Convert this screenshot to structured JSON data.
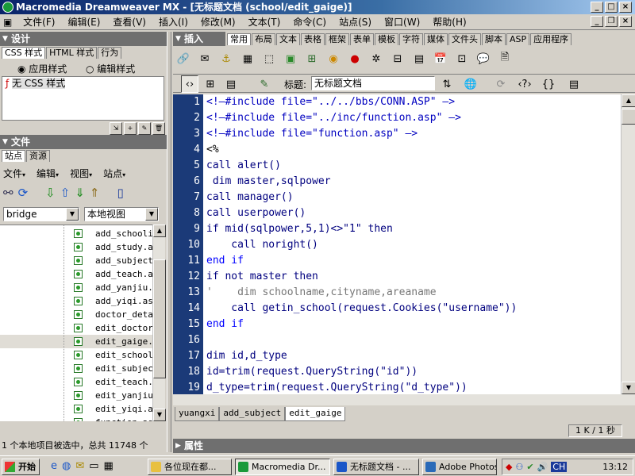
{
  "window": {
    "title": "Macromedia Dreamweaver MX - [无标题文档 (school/edit_gaige)]"
  },
  "menu": [
    "文件(F)",
    "编辑(E)",
    "查看(V)",
    "插入(I)",
    "修改(M)",
    "文本(T)",
    "命令(C)",
    "站点(S)",
    "窗口(W)",
    "帮助(H)"
  ],
  "design_panel": {
    "title": "设计",
    "tabs": [
      "CSS 样式",
      "HTML 样式",
      "行为"
    ],
    "radio_apply": "应用样式",
    "radio_edit": "编辑样式",
    "no_css": "无 CSS 样式"
  },
  "files_panel": {
    "title": "文件",
    "tabs": [
      "站点",
      "资源"
    ],
    "menus": [
      "文件",
      "编辑",
      "视图",
      "站点"
    ],
    "site_select": "bridge",
    "view_select": "本地视图",
    "files": [
      "add_schoolin",
      "add_study.as",
      "add_subject.",
      "add_teach.as",
      "add_yanjiu.a",
      "add_yiqi.asp",
      "doctor_detai",
      "edit_doctor.",
      "edit_gaige.a",
      "edit_school.",
      "edit_subject",
      "edit_teach.a",
      "edit_yanjiu.",
      "edit_yiqi.as",
      "function.asp"
    ],
    "selected_index": 8,
    "status": "1 个本地项目被选中，总共 11748 个"
  },
  "insert_panel": {
    "title": "插入",
    "tabs": [
      "常用",
      "布局",
      "文本",
      "表格",
      "框架",
      "表单",
      "模板",
      "字符",
      "媒体",
      "文件头",
      "脚本",
      "ASP",
      "应用程序"
    ]
  },
  "doc_toolbar": {
    "title_label": "标题:",
    "title_value": "无标题文档"
  },
  "code_lines": [
    {
      "n": "1",
      "text": "<!—#include file=\"../../bbs/CONN.ASP\" —>",
      "cls": "str"
    },
    {
      "n": "2",
      "text": "<!—#include file=\"../inc/function.asp\" —>",
      "cls": "str"
    },
    {
      "n": "3",
      "text": "<!—#include file=\"function.asp\" —>",
      "cls": "str"
    },
    {
      "n": "4",
      "text": "<%",
      "cls": ""
    },
    {
      "n": "5",
      "text": "call alert()",
      "cls": "fn"
    },
    {
      "n": "6",
      "text": " dim master,sqlpower",
      "cls": "fn"
    },
    {
      "n": "7",
      "text": "call manager()",
      "cls": "fn"
    },
    {
      "n": "8",
      "text": "call userpower()",
      "cls": "fn"
    },
    {
      "n": "9",
      "text": "if mid(sqlpower,5,1)<>\"1\" then",
      "cls": "fn"
    },
    {
      "n": "10",
      "text": "    call noright()",
      "cls": "fn"
    },
    {
      "n": "11",
      "text": "end if",
      "cls": "kw"
    },
    {
      "n": "12",
      "text": "if not master then",
      "cls": "fn"
    },
    {
      "n": "13",
      "text": "'    dim schoolname,cityname,areaname",
      "cls": "gray"
    },
    {
      "n": "14",
      "text": "    call getin_school(request.Cookies(\"username\"))",
      "cls": "fn"
    },
    {
      "n": "15",
      "text": "end if",
      "cls": "kw"
    },
    {
      "n": "16",
      "text": "",
      "cls": ""
    },
    {
      "n": "17",
      "text": "dim id,d_type",
      "cls": "fn"
    },
    {
      "n": "18",
      "text": "id=trim(request.QueryString(\"id\"))",
      "cls": "fn"
    },
    {
      "n": "19",
      "text": "d_type=trim(request.QueryString(\"d_type\"))",
      "cls": "fn"
    }
  ],
  "doc_tabs": [
    "yuangxi",
    "add_subject",
    "edit_gaige"
  ],
  "status_right": "1 K / 1 秒",
  "properties_title": "属性",
  "taskbar": {
    "start": "开始",
    "tasks": [
      "各位现在都...",
      "Macromedia Dr...",
      "无标题文档 - ...",
      "Adobe Photos..."
    ],
    "lang": "CH",
    "clock": "13:12"
  }
}
